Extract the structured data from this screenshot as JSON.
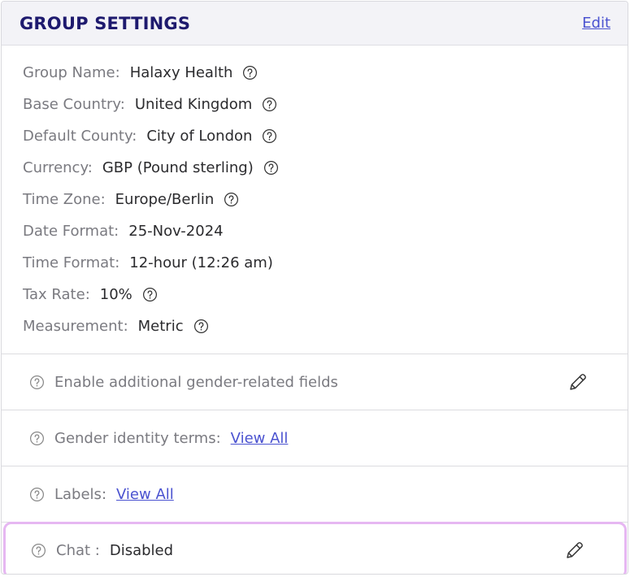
{
  "header": {
    "title": "GROUP SETTINGS",
    "edit_label": "Edit"
  },
  "settings": [
    {
      "label": "Group Name:",
      "value": "Halaxy Health",
      "help": true
    },
    {
      "label": "Base Country:",
      "value": "United Kingdom",
      "help": true
    },
    {
      "label": "Default County:",
      "value": "City of London",
      "help": true
    },
    {
      "label": "Currency:",
      "value": "GBP (Pound sterling)",
      "help": true
    },
    {
      "label": "Time Zone:",
      "value": "Europe/Berlin",
      "help": true
    },
    {
      "label": "Date Format:",
      "value": "25-Nov-2024",
      "help": false
    },
    {
      "label": "Time Format:",
      "value": "12-hour (12:26 am)",
      "help": false
    },
    {
      "label": "Tax Rate:",
      "value": "10%",
      "help": true
    },
    {
      "label": "Measurement:",
      "value": "Metric",
      "help": true
    }
  ],
  "sections": {
    "gender_fields": {
      "label": "Enable additional gender-related fields"
    },
    "gender_terms": {
      "label": "Gender identity terms:",
      "link": "View All"
    },
    "labels": {
      "label": "Labels:",
      "link": "View All"
    },
    "chat": {
      "label": "Chat :",
      "value": "Disabled"
    }
  },
  "icons": {
    "help": "question-circle-icon",
    "edit": "pencil-icon"
  },
  "colors": {
    "title": "#1e1a6e",
    "link": "#4a52d0",
    "highlight": "#e6b7f2",
    "header_bg": "#f3f3f7"
  }
}
